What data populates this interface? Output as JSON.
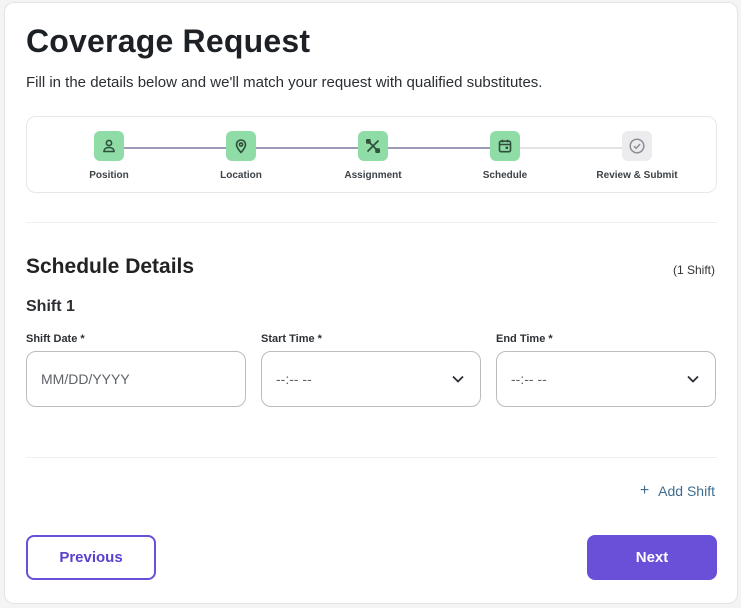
{
  "header": {
    "title": "Coverage Request",
    "subtitle": "Fill in the details below and we'll match your request with qualified substitutes."
  },
  "stepper": {
    "steps": [
      {
        "label": "Position",
        "icon": "person-icon",
        "status": "complete"
      },
      {
        "label": "Location",
        "icon": "map-pin-icon",
        "status": "complete"
      },
      {
        "label": "Assignment",
        "icon": "tools-icon",
        "status": "complete"
      },
      {
        "label": "Schedule",
        "icon": "calendar-icon",
        "status": "current"
      },
      {
        "label": "Review & Submit",
        "icon": "check-circle-icon",
        "status": "pending"
      }
    ],
    "colors": {
      "complete": "#8fdca7",
      "pending": "#ececee",
      "line": "#9b9bb8"
    }
  },
  "schedule": {
    "title": "Schedule Details",
    "count": "(1 Shift)",
    "shift_title": "Shift 1",
    "fields": {
      "date": {
        "label": "Shift Date *",
        "placeholder": "MM/DD/YYYY"
      },
      "start": {
        "label": "Start Time *",
        "placeholder": "--:-- --"
      },
      "end": {
        "label": "End Time *",
        "placeholder": "--:-- --"
      }
    },
    "add_shift": "Add Shift"
  },
  "footer": {
    "previous": "Previous",
    "next": "Next",
    "accent": "#6a4fd8"
  }
}
